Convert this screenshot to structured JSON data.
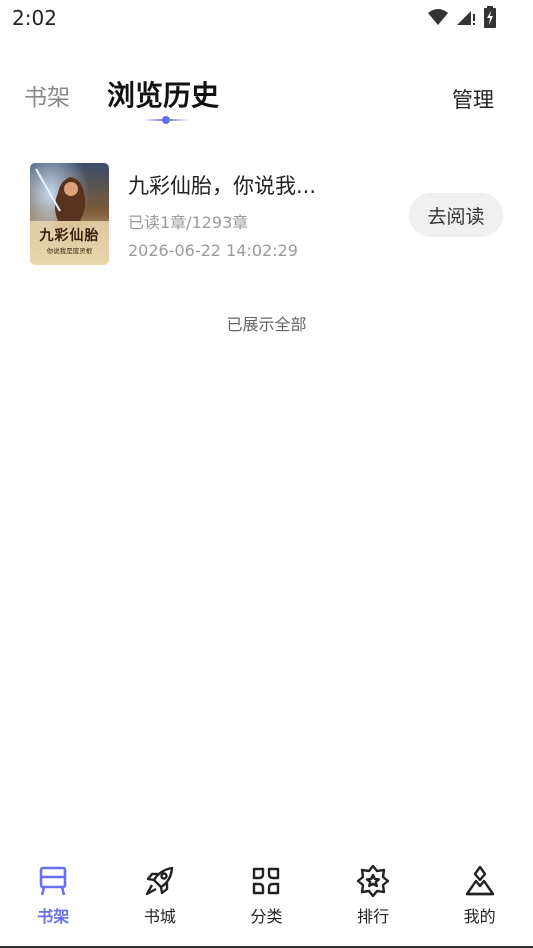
{
  "status_bar": {
    "time": "2:02"
  },
  "header": {
    "tabs": [
      {
        "label": "书架",
        "active": false
      },
      {
        "label": "浏览历史",
        "active": true
      }
    ],
    "manage_label": "管理"
  },
  "history": [
    {
      "title": "九彩仙胎，你说我...",
      "progress": "已读1章/1293章",
      "time": "2026-06-22 14:02:29",
      "action_label": "去阅读",
      "cover": {
        "title": "九彩仙胎",
        "subtitle": "你说我是废灵根"
      }
    }
  ],
  "end_note": "已展示全部",
  "bottom_nav": {
    "items": [
      {
        "label": "书架",
        "icon": "bookshelf-icon",
        "active": true
      },
      {
        "label": "书城",
        "icon": "rocket-icon",
        "active": false
      },
      {
        "label": "分类",
        "icon": "category-icon",
        "active": false
      },
      {
        "label": "排行",
        "icon": "ranking-icon",
        "active": false
      },
      {
        "label": "我的",
        "icon": "profile-icon",
        "active": false
      }
    ]
  },
  "colors": {
    "accent": "#6a6ff0",
    "text": "#222222",
    "muted": "#9a9a9a",
    "button_bg": "#f0f0f0"
  }
}
